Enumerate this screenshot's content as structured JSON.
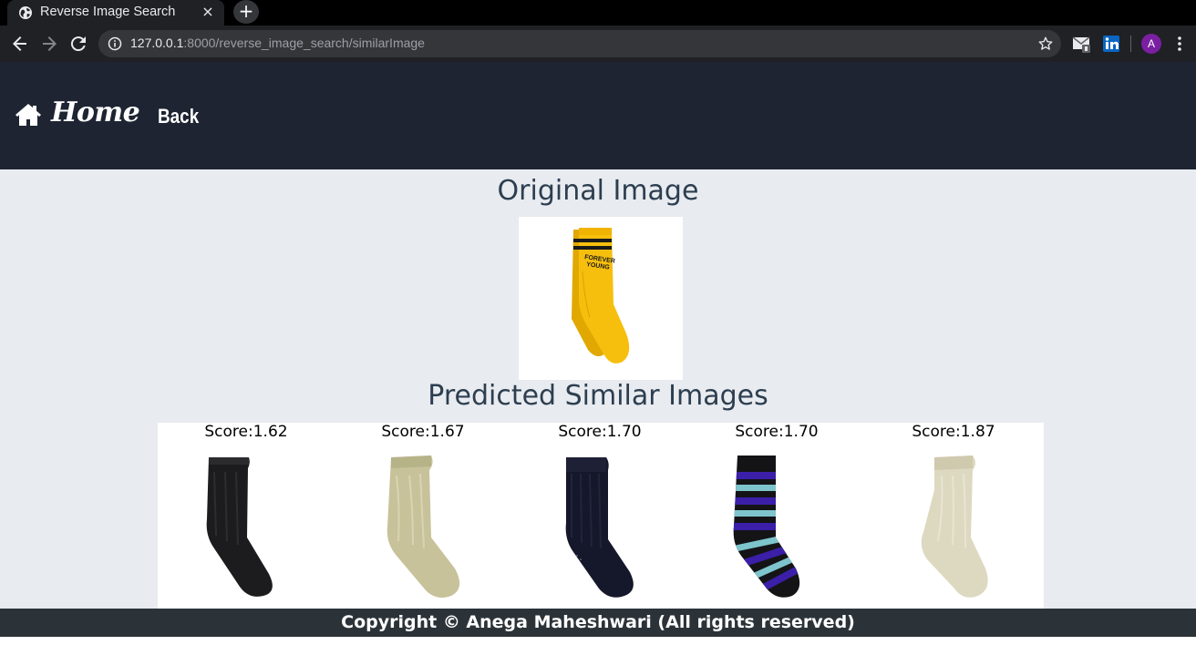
{
  "browser": {
    "tab_title": "Reverse Image Search",
    "close_glyph": "×",
    "new_tab_glyph": "+",
    "url_host": "127.0.0.1",
    "url_path": ":8000/reverse_image_search/similarImage",
    "profile_initial": "A",
    "icons": [
      "globe-icon",
      "back-arrow-icon",
      "forward-arrow-icon",
      "reload-icon",
      "info-icon",
      "star-icon",
      "gmail-extension-icon",
      "linkedin-extension-icon",
      "kebab-menu-icon"
    ]
  },
  "navbar": {
    "home_label": "Home",
    "back_label": "Back",
    "bg_color": "#1e2432"
  },
  "main": {
    "original_heading": "Original Image",
    "original_image": {
      "description_icon": "yellow-sock-image",
      "sock_text_line1": "FOREVER",
      "sock_text_line2": "YOUNG"
    },
    "predicted_heading": "Predicted Similar Images",
    "results": [
      {
        "score": "Score:1.62",
        "image": "black-sock-image"
      },
      {
        "score": "Score:1.67",
        "image": "beige-sock-image"
      },
      {
        "score": "Score:1.70",
        "image": "navy-sock-image"
      },
      {
        "score": "Score:1.70",
        "image": "striped-sock-image"
      },
      {
        "score": "Score:1.87",
        "image": "cream-sock-image"
      }
    ]
  },
  "footer": {
    "text": "Copyright © Anega Maheshwari (All rights reserved)"
  },
  "colors": {
    "page_bg": "#e8ebef",
    "heading": "#2c3e50",
    "footer_bg": "#2c3338"
  }
}
